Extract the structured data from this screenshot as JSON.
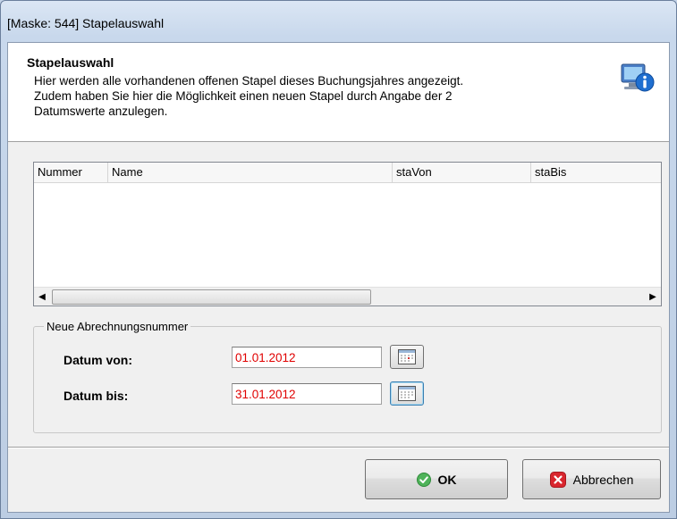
{
  "window": {
    "title": "[Maske: 544] Stapelauswahl"
  },
  "header": {
    "title": "Stapelauswahl",
    "description": "Hier werden alle vorhandenen offenen Stapel dieses Buchungsjahres angezeigt.\nZudem haben Sie hier die Möglichkeit einen neuen Stapel durch Angabe der 2\nDatumswerte anzulegen.",
    "icon": "info-computer-icon"
  },
  "grid": {
    "columns": [
      "Nummer",
      "Name",
      "staVon",
      "staBis"
    ],
    "rows": []
  },
  "group": {
    "legend": "Neue Abrechnungsnummer",
    "datum_von_label": "Datum von:",
    "datum_von_value": "01.01.2012",
    "datum_bis_label": "Datum bis:",
    "datum_bis_value": "31.01.2012"
  },
  "buttons": {
    "ok_label": "OK",
    "cancel_label": "Abbrechen"
  },
  "colors": {
    "date_text": "#e00000",
    "ok_icon": "#3aa24a",
    "cancel_icon": "#d9262e"
  }
}
